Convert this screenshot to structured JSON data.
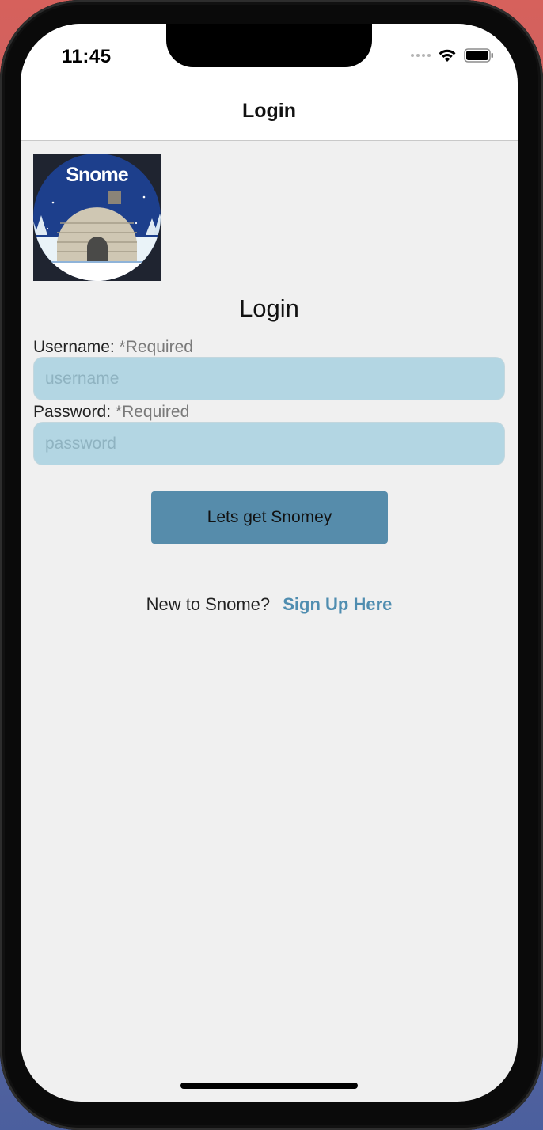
{
  "status_bar": {
    "time": "11:45"
  },
  "nav": {
    "title": "Login"
  },
  "logo": {
    "text": "Snome",
    "colors": {
      "sky": "#1d3f8c",
      "snow": "#ffffff",
      "igloo": "#cfc7b3"
    }
  },
  "main": {
    "heading": "Login",
    "username": {
      "label": "Username:",
      "required": "*Required",
      "placeholder": "username",
      "value": ""
    },
    "password": {
      "label": "Password:",
      "required": "*Required",
      "placeholder": "password",
      "value": ""
    },
    "submit_label": "Lets get Snomey",
    "signup_prompt": "New to Snome?",
    "signup_link": "Sign Up Here"
  },
  "colors": {
    "input_bg": "#b3d6e3",
    "button_bg": "#568cab",
    "link": "#4f8db0",
    "screen_bg": "#f0f0f0"
  }
}
